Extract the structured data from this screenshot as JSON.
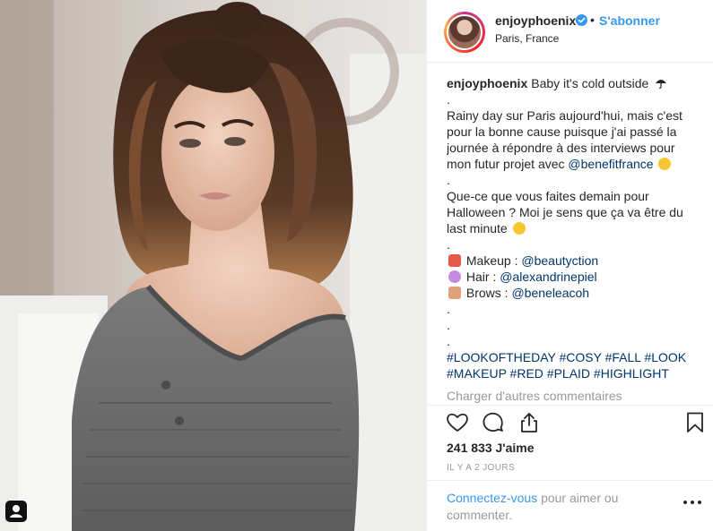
{
  "photo": {
    "alt_icon": "user-tag-icon"
  },
  "header": {
    "username": "enjoyphoenix",
    "separator": "•",
    "follow_label": "S'abonner",
    "location": "Paris, France",
    "verified_icon": "verified-badge-icon"
  },
  "caption": {
    "author": "enjoyphoenix",
    "title": "Baby it's cold outside",
    "lines": [
      ".",
      "Rainy day sur Paris aujourd'hui, mais c'est",
      "pour la bonne cause puisque j'ai passé la",
      "journée à répondre à des interviews pour",
      "mon futur projet avec",
      ".",
      "Que-ce que vous faites demain pour",
      "Halloween ? Moi je sens que ça va être du",
      "last minute",
      ".",
      "Makeup :",
      "Hair :",
      "Brows :",
      ".",
      ".",
      "."
    ],
    "mention_benefit": "@benefitfrance",
    "mention_makeup": "@beautyction",
    "mention_hair": "@alexandrinepiel",
    "mention_brows": "@beneleacoh",
    "hashtags_line1": "#LOOKOFTHEDAY #COSY #FALL #LOOK",
    "hashtags_line2": "#MAKEUP #RED #PLAID #HIGHLIGHT"
  },
  "load_more_label": "Charger d'autres commentaires",
  "actions": {
    "like_icon": "heart-icon",
    "comment_icon": "comment-icon",
    "share_icon": "share-icon",
    "save_icon": "bookmark-icon"
  },
  "likes_label": "241 833 J'aime",
  "timestamp": "IL Y A 2 JOURS",
  "comment": {
    "link_label": "Connectez-vous",
    "rest_label": "pour aimer ou commenter."
  },
  "colors": {
    "link_blue": "#3897f0",
    "mention_navy": "#003569",
    "muted": "#999999"
  }
}
